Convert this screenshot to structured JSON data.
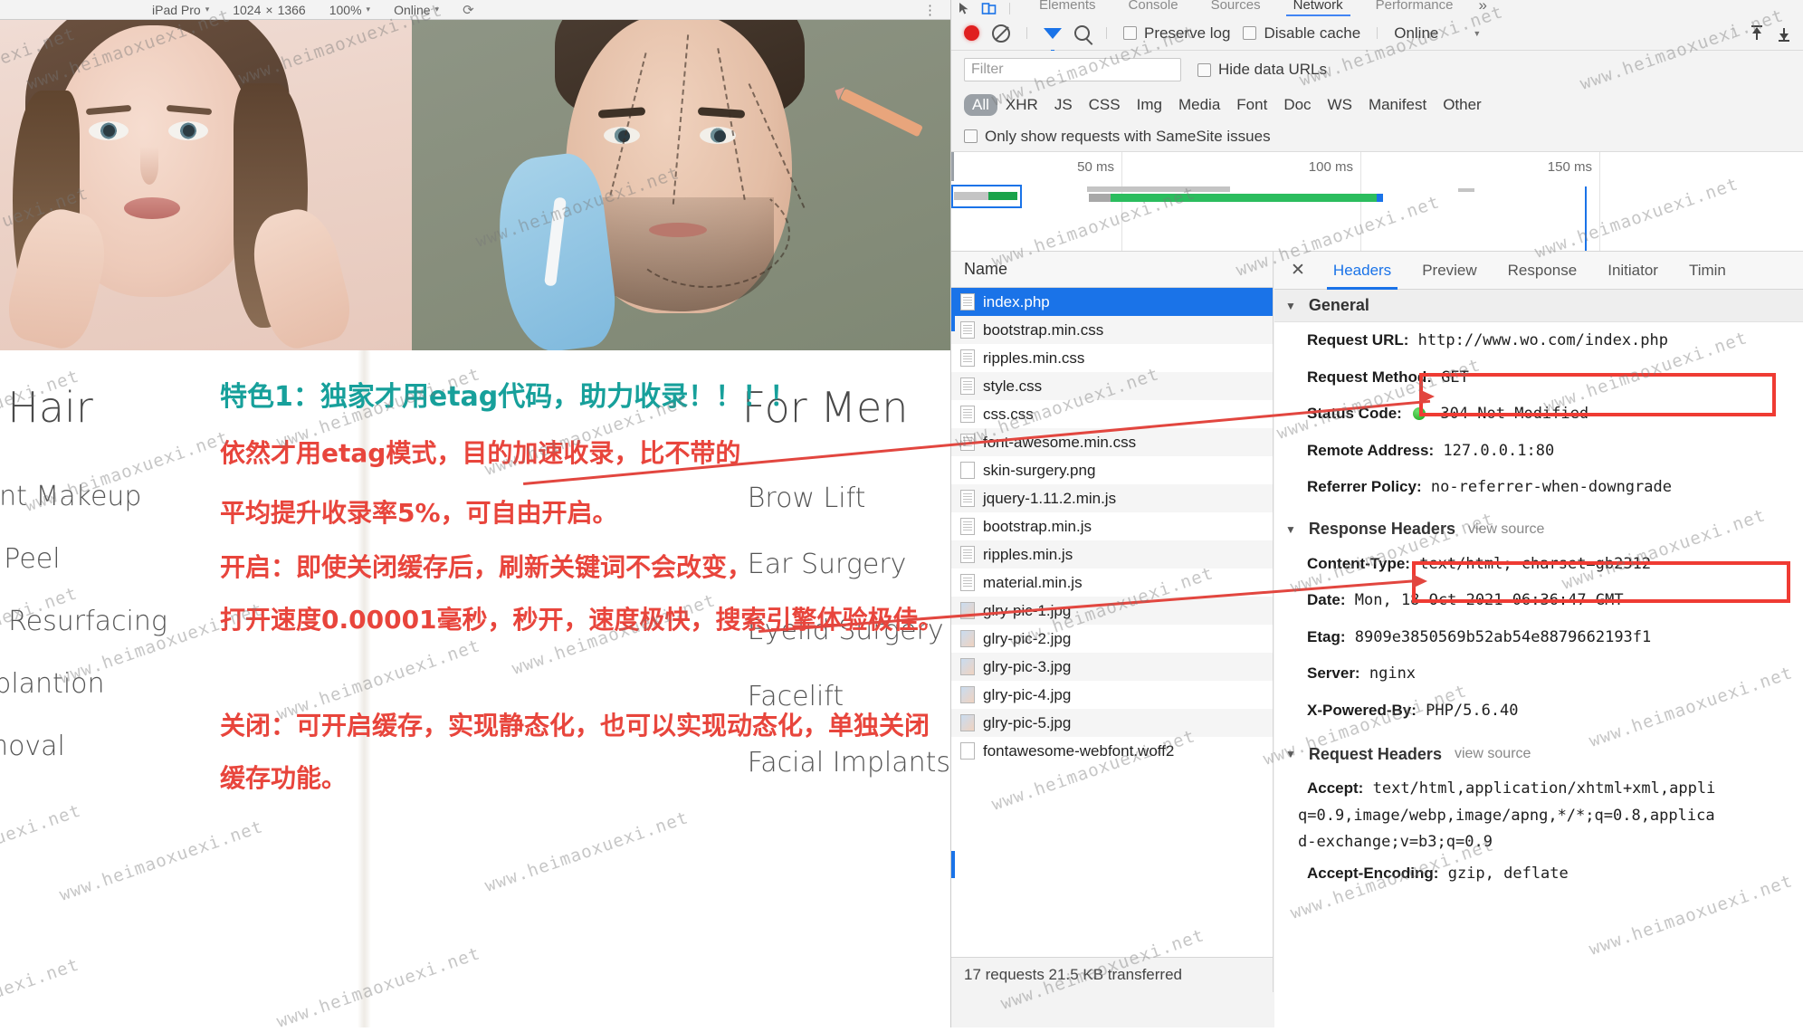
{
  "device_bar": {
    "device": "iPad Pro",
    "width": "1024",
    "times": "×",
    "height": "1366",
    "zoom": "100%",
    "throttle": "Online",
    "rotate_icon": "rotate-icon",
    "more_icon": "more-options-icon"
  },
  "webpage": {
    "col1": {
      "title": "n & Hair",
      "items": [
        "manent Makeup",
        "mical Peel",
        "r Skin Resurfacing",
        " Transplantion",
        "o Removal"
      ]
    },
    "col2": {
      "title": "For Men",
      "items": [
        "Brow Lift",
        "Ear Surgery",
        "Eyelid Surgery",
        "Facelift",
        "Facial Implants"
      ]
    }
  },
  "annotations": {
    "heading": "特色1：独家才用etag代码，助力收录！！！！",
    "heading_color": "#17a09b",
    "red_color": "#e8453c",
    "lines": [
      "依然才用etag模式，目的加速收录，比不带的",
      "平均提升收录率5%，可自由开启。",
      "开启：即使关闭缓存后，刷新关键词不会改变，",
      "打开速度0.00001毫秒，秒开，速度极快，搜索引擎体验极佳。",
      "关闭：可开启缓存，实现静态化，也可以实现动态化，单独关闭",
      "缓存功能。"
    ]
  },
  "devtools": {
    "tabs": [
      {
        "label": "Elements",
        "active": false
      },
      {
        "label": "Console",
        "active": false
      },
      {
        "label": "Sources",
        "active": false
      },
      {
        "label": "Network",
        "active": true
      },
      {
        "label": "Performance",
        "active": false
      }
    ],
    "more_tabs": "»",
    "icons": {
      "inspect": "inspect-element-icon",
      "device": "device-toolbar-icon",
      "record": "record-icon",
      "clear": "clear-icon",
      "filter": "filter-icon",
      "search": "search-icon",
      "import_har": "import-har-icon",
      "export_har": "export-har-icon"
    },
    "toolbar": {
      "preserve_log": "Preserve log",
      "disable_cache": "Disable cache",
      "throttle": "Online",
      "throttle_caret": "▼"
    },
    "filter": {
      "placeholder": "Filter",
      "value": "",
      "hide_data_urls": "Hide data URLs"
    },
    "types": [
      "All",
      "XHR",
      "JS",
      "CSS",
      "Img",
      "Media",
      "Font",
      "Doc",
      "WS",
      "Manifest",
      "Other"
    ],
    "active_type": "All",
    "samesite": "Only show requests with SameSite issues",
    "overview": {
      "ticks": [
        "50 ms",
        "100 ms",
        "150 ms"
      ]
    },
    "request_table": {
      "column_header": "Name",
      "rows": [
        {
          "name": "index.php",
          "icon": "doc",
          "selected": true
        },
        {
          "name": "bootstrap.min.css",
          "icon": "doc",
          "selected": false
        },
        {
          "name": "ripples.min.css",
          "icon": "doc",
          "selected": false
        },
        {
          "name": "style.css",
          "icon": "doc",
          "selected": false
        },
        {
          "name": "css.css",
          "icon": "doc",
          "selected": false
        },
        {
          "name": "font-awesome.min.css",
          "icon": "doc",
          "selected": false
        },
        {
          "name": "skin-surgery.png",
          "icon": "blank",
          "selected": false
        },
        {
          "name": "jquery-1.11.2.min.js",
          "icon": "doc",
          "selected": false
        },
        {
          "name": "bootstrap.min.js",
          "icon": "doc",
          "selected": false
        },
        {
          "name": "ripples.min.js",
          "icon": "doc",
          "selected": false
        },
        {
          "name": "material.min.js",
          "icon": "doc",
          "selected": false
        },
        {
          "name": "glry-pic-1.jpg",
          "icon": "img",
          "selected": false
        },
        {
          "name": "glry-pic-2.jpg",
          "icon": "img",
          "selected": false
        },
        {
          "name": "glry-pic-3.jpg",
          "icon": "img",
          "selected": false
        },
        {
          "name": "glry-pic-4.jpg",
          "icon": "img",
          "selected": false
        },
        {
          "name": "glry-pic-5.jpg",
          "icon": "img",
          "selected": false
        },
        {
          "name": "fontawesome-webfont.woff2",
          "icon": "blank",
          "selected": false
        }
      ],
      "summary": "17 requests   21.5 KB transferred"
    },
    "detail": {
      "close_icon": "close-icon",
      "tabs": [
        {
          "label": "Headers",
          "active": true
        },
        {
          "label": "Preview",
          "active": false
        },
        {
          "label": "Response",
          "active": false
        },
        {
          "label": "Initiator",
          "active": false
        },
        {
          "label": "Timin",
          "active": false
        }
      ],
      "general": {
        "title": "General",
        "rows": [
          {
            "key": "Request URL:",
            "value": "http://www.wo.com/index.php"
          },
          {
            "key": "Request Method:",
            "value": "GET"
          },
          {
            "key": "Status Code:",
            "value": "304 Not Modified",
            "dot": true,
            "highlighted": true
          },
          {
            "key": "Remote Address:",
            "value": "127.0.0.1:80"
          },
          {
            "key": "Referrer Policy:",
            "value": "no-referrer-when-downgrade"
          }
        ]
      },
      "response_headers": {
        "title": "Response Headers",
        "view_source": "view source",
        "rows": [
          {
            "key": "Content-Type:",
            "value": "text/html; charset=gb2312"
          },
          {
            "key": "Date:",
            "value": "Mon, 18 Oct 2021 06:36:47 GMT"
          },
          {
            "key": "Etag:",
            "value": "8909e3850569b52ab54e8879662193f1",
            "highlighted": true
          },
          {
            "key": "Server:",
            "value": "nginx"
          },
          {
            "key": "X-Powered-By:",
            "value": "PHP/5.6.40"
          }
        ]
      },
      "request_headers": {
        "title": "Request Headers",
        "view_source": "view source",
        "rows": [
          {
            "key": "Accept:",
            "value": "text/html,application/xhtml+xml,appli"
          },
          {
            "key": "",
            "value": "q=0.9,image/webp,image/apng,*/*;q=0.8,applica"
          },
          {
            "key": "",
            "value": "d-exchange;v=b3;q=0.9"
          },
          {
            "key": "Accept-Encoding:",
            "value": "gzip, deflate"
          }
        ]
      }
    }
  },
  "watermark": {
    "text": "www.heimaoxuexi.net",
    "short": "uexi.net"
  }
}
